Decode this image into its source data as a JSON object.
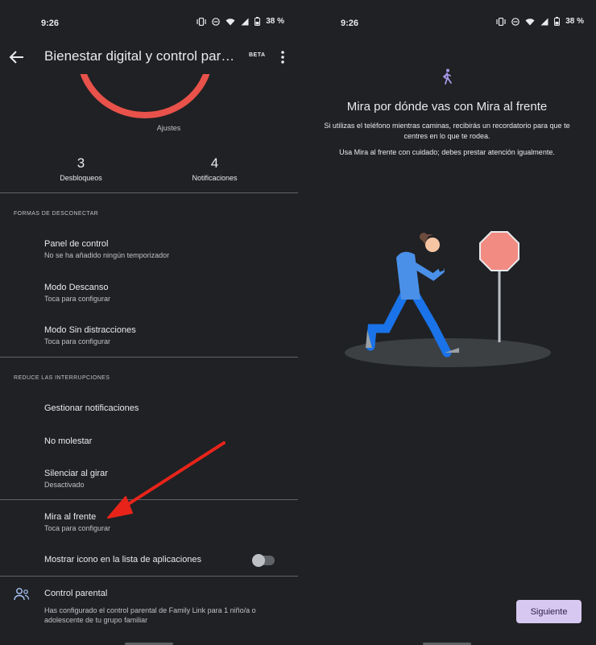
{
  "status": {
    "time": "9:26",
    "battery": "38 %"
  },
  "left": {
    "title": "Bienestar digital y control par…",
    "beta": "BETA",
    "chart_caption": "Ajustes",
    "stats": [
      {
        "value": "3",
        "label": "Desbloqueos"
      },
      {
        "value": "4",
        "label": "Notificaciones"
      }
    ],
    "section1": "FORMAS DE DESCONECTAR",
    "items1": [
      {
        "title": "Panel de control",
        "subtitle": "No se ha añadido ningún temporizador"
      },
      {
        "title": "Modo Descanso",
        "subtitle": "Toca para configurar"
      },
      {
        "title": "Modo Sin distracciones",
        "subtitle": "Toca para configurar"
      }
    ],
    "section2": "REDUCE LAS INTERRUPCIONES",
    "items2": [
      {
        "title": "Gestionar notificaciones"
      },
      {
        "title": "No molestar"
      },
      {
        "title": "Silenciar al girar",
        "subtitle": "Desactivado"
      },
      {
        "title": "Mira al frente",
        "subtitle": "Toca para configurar"
      },
      {
        "title": "Mostrar icono en la lista de aplicaciones"
      }
    ],
    "parental": {
      "title": "Control parental",
      "subtitle": "Has configurado el control parental de Family Link para 1 niño/a o adolescente de tu grupo familiar"
    },
    "toggle_on": false,
    "arrow_color": "#e8241a",
    "accent_red": "#e8524a"
  },
  "right": {
    "title": "Mira por dónde vas con Mira al frente",
    "body": "Si utilizas el teléfono mientras caminas, recibirás un recordatorio para que te centres en lo que te rodea.",
    "body2": "Usa Mira al frente con cuidado; debes prestar atención igualmente.",
    "next": "Siguiente",
    "button_color": "#d7c8f2"
  }
}
